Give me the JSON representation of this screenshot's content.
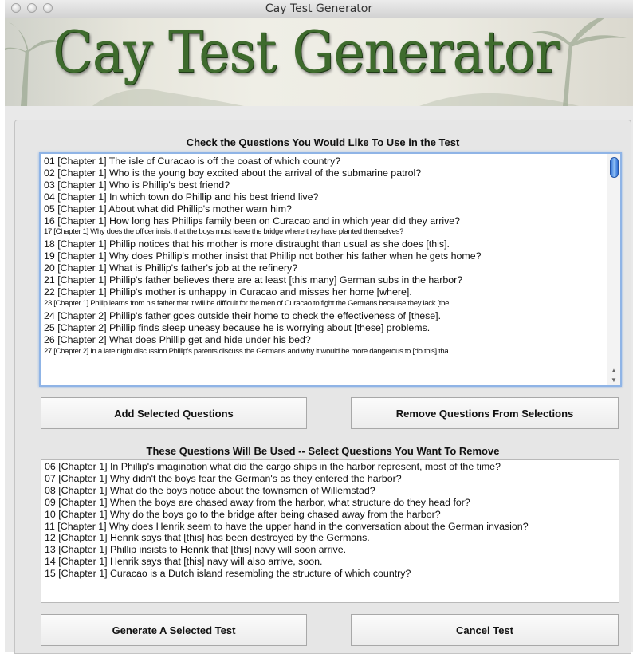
{
  "window": {
    "title": "Cay Test Generator"
  },
  "banner": {
    "logo_text": "Cay Test Generator"
  },
  "available_section": {
    "heading": "Check the Questions You Would Like To Use in the Test",
    "questions": [
      "01 [Chapter 1] The isle of Curacao is off the coast of which country?",
      "02 [Chapter 1] Who is the young boy excited about the arrival of the submarine patrol?",
      "03 [Chapter 1] Who is Phillip's best friend?",
      "04 [Chapter 1] In which town do Phillip and his best friend live?",
      "05 [Chapter 1] About what did Phillip's mother warn him?",
      "16 [Chapter 1] How long has Phillips family been on Curacao and in which year did they arrive?",
      "17 [Chapter 1] Why does the officer insist that the boys must leave the bridge where they have planted themselves?",
      "18 [Chapter 1] Phillip notices that his mother is more distraught than usual as she does [this].",
      "19 [Chapter 1] Why does Phillip's mother insist that Phillip not bother his father when he gets home?",
      "20 [Chapter 1] What is Phillip's father's job at the refinery?",
      "21 [Chapter 1] Phillip's father believes there are at least [this many] German subs in the harbor?",
      "22 [Chapter 1] Phillip's mother is unhappy in Curacao and misses her home [where].",
      "23 [Chapter 1] Philip learns from his father that it will be difficult for the men of Curacao to fight the Germans because they lack [the...",
      "24 [Chapter 2] Phillip's father goes outside their home to check the effectiveness of [these].",
      "25 [Chapter 2] Phillip finds sleep uneasy because he is worrying about [these] problems.",
      "26 [Chapter 2] What does Phillip get and hide under his bed?",
      "27 [Chapter 2] In a late night discussion Phillip's parents discuss the Germans and why it would be more dangerous to [do this] tha..."
    ]
  },
  "buttons": {
    "add_selected": "Add Selected Questions",
    "remove_from_selections": "Remove Questions From Selections",
    "generate_test": "Generate A Selected Test",
    "cancel_test": "Cancel Test"
  },
  "selected_section": {
    "heading": "These Questions Will Be Used -- Select Questions You Want To Remove",
    "questions": [
      "06 [Chapter 1] In Phillip's imagination what did the cargo ships in the harbor represent, most of the time?",
      "07 [Chapter 1] Why didn't the boys fear the German's as they entered the harbor?",
      "08 [Chapter 1] What do the boys notice about the townsmen of Willemstad?",
      "09 [Chapter 1] When the boys are chased away from the harbor, what structure do they head for?",
      "10 [Chapter 1] Why do the boys go to the bridge after being chased away from the harbor?",
      "11 [Chapter 1] Why does Henrik seem to have the upper hand in the conversation about the German invasion?",
      "12 [Chapter 1]  Henrik says that [this]  has been destroyed by the Germans.",
      "13 [Chapter 1] Phillip insists to Henrik that [this] navy will soon arrive.",
      "14 [Chapter 1] Henrik says that [this] navy will also arrive, soon.",
      "15 [Chapter 1] Curacao is a Dutch island resembling the structure of which country?"
    ]
  },
  "colors": {
    "logo_green": "#3e6b2d",
    "focus_ring": "#8fb4e6",
    "scroll_thumb": "#2f6fd6"
  }
}
